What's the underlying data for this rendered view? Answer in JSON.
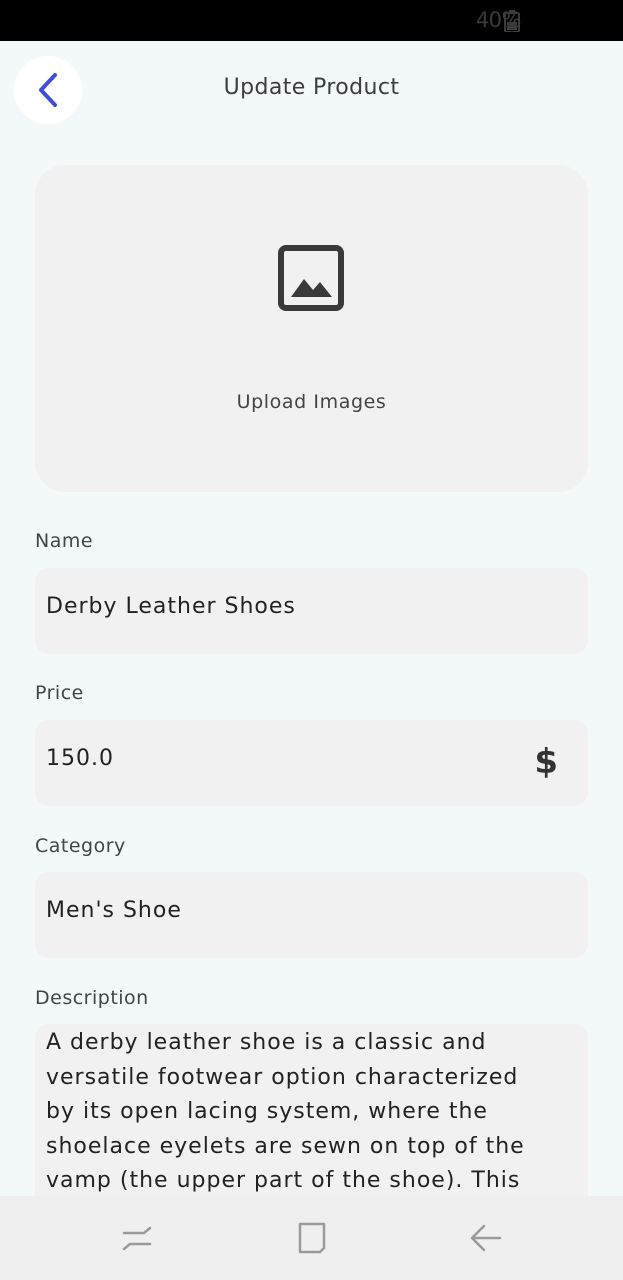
{
  "status_bar": {
    "battery": "40%"
  },
  "header": {
    "title": "Update Product"
  },
  "upload": {
    "label": "Upload Images"
  },
  "form": {
    "name": {
      "label": "Name",
      "value": "Derby Leather Shoes"
    },
    "price": {
      "label": "Price",
      "value": "150.0",
      "suffix": "$"
    },
    "category": {
      "label": "Category",
      "value": "Men's Shoe"
    },
    "description": {
      "label": "Description",
      "value": "A derby leather shoe is a classic and\nversatile footwear option characterized\nby its open lacing system, where the\nshoelace eyelets are sewn on top of the\nvamp (the upper part of the shoe). This"
    }
  },
  "colors": {
    "accent": "#3d4fd6",
    "field_bg": "#f1f1f1",
    "page_bg": "#f3f8f8"
  },
  "icons": [
    "back-chevron-icon",
    "image-icon",
    "dollar-icon",
    "recent-apps-icon",
    "home-icon",
    "system-back-icon",
    "battery-icon"
  ]
}
